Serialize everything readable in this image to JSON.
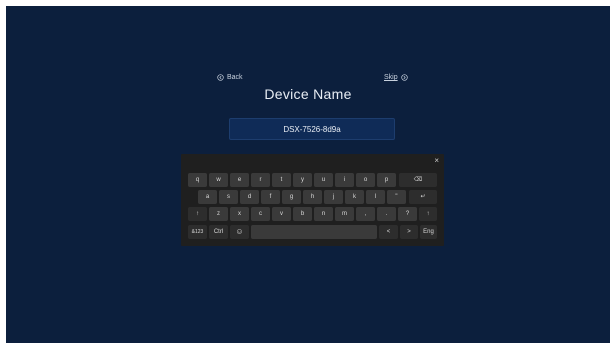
{
  "nav": {
    "back_label": "Back",
    "skip_label": "Skip"
  },
  "page": {
    "title": "Device Name"
  },
  "device_name_field": {
    "value": "DSX-7526-8d9a"
  },
  "keyboard": {
    "close_glyph": "×",
    "row1": [
      "q",
      "w",
      "e",
      "r",
      "t",
      "y",
      "u",
      "i",
      "o",
      "p"
    ],
    "row1_backspace": "⌫",
    "row2": [
      "a",
      "s",
      "d",
      "f",
      "g",
      "h",
      "j",
      "k",
      "l",
      "\""
    ],
    "row2_enter": "↵",
    "row3_shift_left": "↑",
    "row3": [
      "z",
      "x",
      "c",
      "v",
      "b",
      "n",
      "m",
      ",",
      ".",
      "?"
    ],
    "row3_shift_right": "↑",
    "row4_symbols": "&123",
    "row4_ctrl": "Ctrl",
    "row4_emoji": "☺",
    "row4_left": "<",
    "row4_right": ">",
    "row4_lang": "Eng"
  },
  "colors": {
    "background": "#0c1f3d",
    "field_bg": "#0f2b57",
    "keyboard_bg": "#1f1f1f",
    "key_bg": "#3a3a3a"
  }
}
